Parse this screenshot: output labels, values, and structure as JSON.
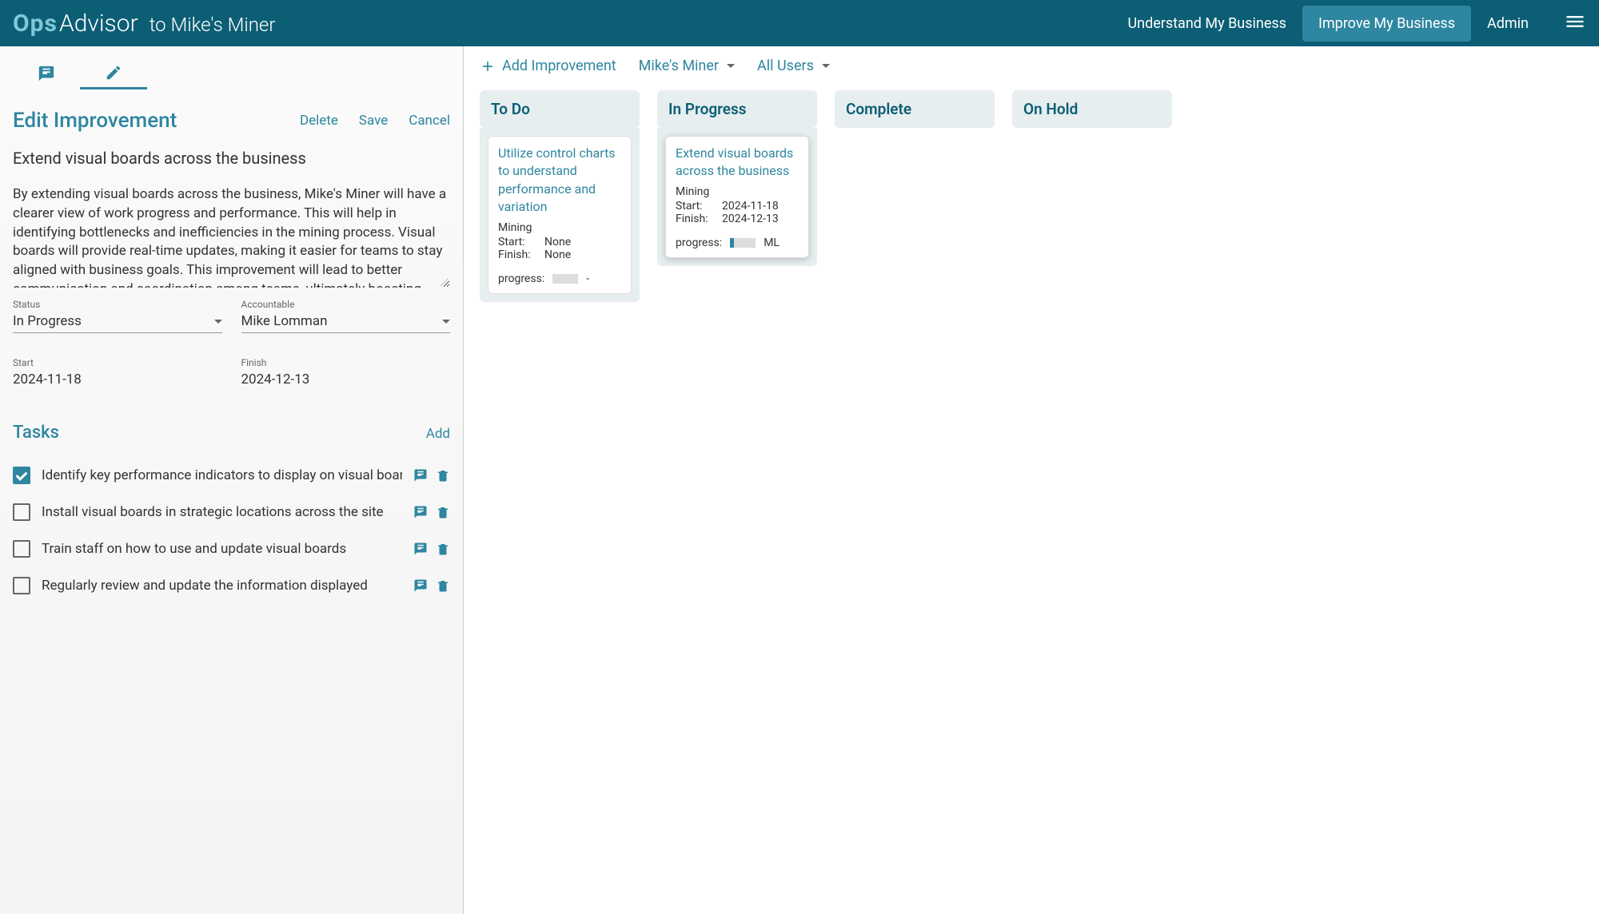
{
  "header": {
    "logo_ops": "Ops",
    "logo_advisor": "Advisor",
    "to_text": "to Mike's Miner",
    "nav": {
      "understand": "Understand My Business",
      "improve": "Improve My Business",
      "admin": "Admin"
    }
  },
  "left": {
    "edit_title": "Edit Improvement",
    "actions": {
      "delete": "Delete",
      "save": "Save",
      "cancel": "Cancel"
    },
    "improvement_title": "Extend visual boards across the business",
    "improvement_desc": "By extending visual boards across the business, Mike's Miner will have a clearer view of work progress and performance. This will help in identifying bottlenecks and inefficiencies in the mining process. Visual boards will provide real-time updates, making it easier for teams to stay aligned with business goals. This improvement will lead to better communication and coordination among teams, ultimately boosting",
    "status_label": "Status",
    "status_value": "In Progress",
    "accountable_label": "Accountable",
    "accountable_value": "Mike Lomman",
    "start_label": "Start",
    "start_value": "2024-11-18",
    "finish_label": "Finish",
    "finish_value": "2024-12-13",
    "tasks_title": "Tasks",
    "add_label": "Add",
    "tasks": [
      {
        "label": "Identify key performance indicators to display on visual boar",
        "checked": true
      },
      {
        "label": "Install visual boards in strategic locations across the site",
        "checked": false
      },
      {
        "label": "Train staff on how to use and update visual boards",
        "checked": false
      },
      {
        "label": "Regularly review and update the information displayed",
        "checked": false
      }
    ]
  },
  "right": {
    "toolbar": {
      "add_improvement": "Add Improvement",
      "business_select": "Mike's Miner",
      "users_select": "All Users"
    },
    "columns": [
      {
        "name": "To Do",
        "cards": [
          {
            "title": "Utilize control charts to understand performance and variation",
            "category": "Mining",
            "start": "None",
            "finish": "None",
            "progress_pct": 0,
            "initials": "-"
          }
        ]
      },
      {
        "name": "In Progress",
        "cards": [
          {
            "title": "Extend visual boards across the business",
            "category": "Mining",
            "start": "2024-11-18",
            "finish": "2024-12-13",
            "progress_pct": 15,
            "initials": "ML",
            "selected": true
          }
        ]
      },
      {
        "name": "Complete",
        "cards": []
      },
      {
        "name": "On Hold",
        "cards": []
      }
    ],
    "labels": {
      "start": "Start:",
      "finish": "Finish:",
      "progress": "progress:"
    }
  }
}
